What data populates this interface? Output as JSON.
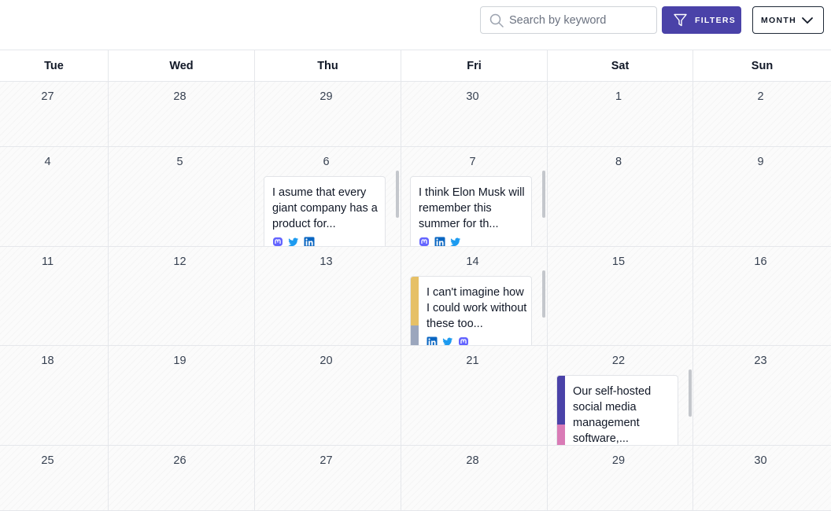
{
  "toolbar": {
    "search_placeholder": "Search by keyword",
    "search_value": "",
    "filters_label": "FILTERS",
    "view_label": "MONTH",
    "accent_color": "#4a42a8"
  },
  "calendar": {
    "weekdays": [
      "Tue",
      "Wed",
      "Thu",
      "Fri",
      "Sat",
      "Sun"
    ],
    "weeks": [
      [
        "27",
        "28",
        "29",
        "30",
        "1",
        "2"
      ],
      [
        "4",
        "5",
        "6",
        "7",
        "8",
        "9"
      ],
      [
        "11",
        "12",
        "13",
        "14",
        "15",
        "16"
      ],
      [
        "18",
        "19",
        "20",
        "21",
        "22",
        "23"
      ],
      [
        "25",
        "26",
        "27",
        "28",
        "29",
        "30"
      ]
    ]
  },
  "posts": [
    {
      "day": "6",
      "text": "I asume that every giant company has a product for...",
      "networks": [
        "mastodon-icon",
        "twitter-icon",
        "linkedin-icon"
      ],
      "stripes": []
    },
    {
      "day": "7",
      "text": "I think Elon Musk will remember this summer for th...",
      "networks": [
        "mastodon-icon",
        "linkedin-icon",
        "twitter-icon"
      ],
      "stripes": []
    },
    {
      "day": "14",
      "text": "I can't imagine how I could work without these too...",
      "networks": [
        "linkedin-icon",
        "twitter-icon",
        "mastodon-icon"
      ],
      "stripes": [
        "#e6c066",
        "#9ba6bd"
      ]
    },
    {
      "day": "22",
      "text": "Our self-hosted social media management software,...",
      "networks": [],
      "stripes": [
        "#4a42a8",
        "#d97bb6"
      ]
    }
  ],
  "colors": {
    "mastodon": "#6364ff",
    "twitter": "#1d9bf0",
    "linkedin": "#0a66c2"
  }
}
